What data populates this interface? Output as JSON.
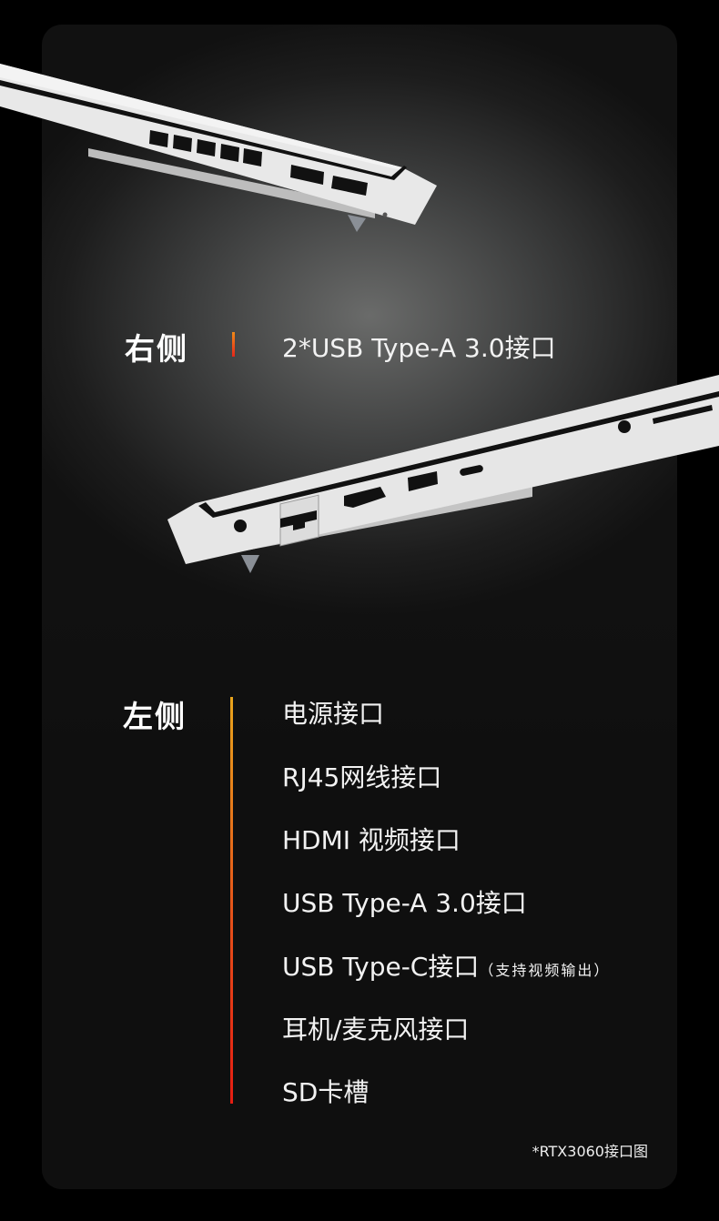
{
  "right_side": {
    "title": "右侧",
    "items": [
      "2*USB Type-A 3.0接口"
    ]
  },
  "left_side": {
    "title": "左侧",
    "items": [
      {
        "label": "电源接口"
      },
      {
        "label": "RJ45网线接口"
      },
      {
        "label": "HDMI 视频接口"
      },
      {
        "label": "USB Type-A 3.0接口"
      },
      {
        "label": "USB Type-C接口",
        "note": "（支持视频输出）"
      },
      {
        "label": "耳机/麦克风接口"
      },
      {
        "label": "SD卡槽"
      }
    ]
  },
  "footnote": "*RTX3060接口图",
  "colors": {
    "accent_top": "#e8a41c",
    "accent_bottom": "#e51d12",
    "background": "#0f0f0f",
    "chassis": "#e6e6e6"
  }
}
